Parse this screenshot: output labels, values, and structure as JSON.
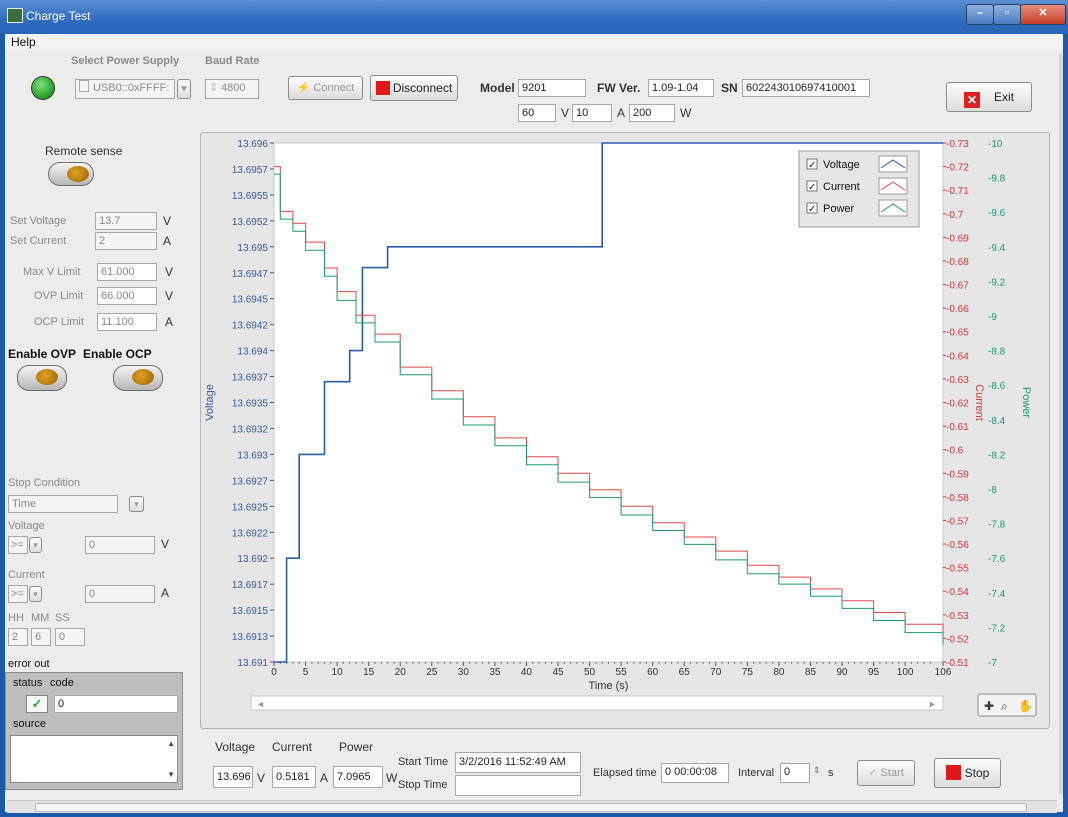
{
  "window": {
    "title": "Charge Test"
  },
  "menu": {
    "help": "Help"
  },
  "supply": {
    "select_label": "Select Power Supply",
    "port": "USB0::0xFFFF:",
    "baud_label": "Baud Rate",
    "baud": "4800",
    "connect_label": "Connect",
    "disconnect_label": "Disconnect",
    "status_color": "#2ea62e"
  },
  "device": {
    "model_label": "Model",
    "model": "9201",
    "fw_label": "FW Ver.",
    "fw": "1.09-1.04",
    "sn_label": "SN",
    "sn": "602243010697410001",
    "max_v": "60",
    "max_v_unit": "V",
    "max_a": "10",
    "max_a_unit": "A",
    "max_w": "200",
    "max_w_unit": "W"
  },
  "exit_label": "Exit",
  "settings": {
    "remote_sense": "Remote sense",
    "set_voltage_label": "Set Voltage",
    "set_voltage": "13.7",
    "set_voltage_unit": "V",
    "set_current_label": "Set Current",
    "set_current": "2",
    "set_current_unit": "A",
    "max_v_limit_label": "Max V Limit",
    "max_v_limit": "61.000",
    "max_v_limit_unit": "V",
    "ovp_limit_label": "OVP Limit",
    "ovp_limit": "66.000",
    "ovp_limit_unit": "V",
    "ocp_limit_label": "OCP Limit",
    "ocp_limit": "11.100",
    "ocp_limit_unit": "A",
    "enable_ovp": "Enable OVP",
    "enable_ocp": "Enable OCP"
  },
  "stop_condition": {
    "label": "Stop Condition",
    "mode": "Time",
    "voltage_label": "Voltage",
    "voltage_op": ">=",
    "voltage_value": "0",
    "voltage_unit": "V",
    "current_label": "Current",
    "current_op": ">=",
    "current_value": "0",
    "current_unit": "A",
    "hh_label": "HH",
    "mm_label": "MM",
    "ss_label": "SS",
    "hh": "2",
    "mm": "6",
    "ss": "0"
  },
  "error_out": {
    "title": "error out",
    "status_label": "status",
    "code_label": "code",
    "code": "0",
    "source_label": "source"
  },
  "readings": {
    "voltage_label": "Voltage",
    "voltage": "13.696",
    "voltage_unit": "V",
    "current_label": "Current",
    "current": "0.5181",
    "current_unit": "A",
    "power_label": "Power",
    "power": "7.0965",
    "power_unit": "W",
    "start_time_label": "Start Time",
    "start_time": "3/2/2016 11:52:49 AM",
    "stop_time_label": "Stop Time",
    "stop_time": "",
    "elapsed_label": "Elapsed time",
    "elapsed": "0 00:00:08",
    "interval_label": "Interval",
    "interval": "0",
    "interval_unit": "s",
    "start_label": "Start",
    "stop_label": "Stop"
  },
  "chart_data": {
    "type": "line",
    "xlabel": "Time (s)",
    "ylabel_left": "Voltage",
    "ylabel_right1": "Current",
    "ylabel_right2": "Power",
    "xlim": [
      0,
      106
    ],
    "x_ticks": [
      0,
      5,
      10,
      15,
      20,
      25,
      30,
      35,
      40,
      45,
      50,
      55,
      60,
      65,
      70,
      75,
      80,
      85,
      90,
      95,
      100,
      106
    ],
    "y_left_ticks": [
      "13.696",
      "13.6957",
      "13.6955",
      "13.6952",
      "13.695",
      "13.6947",
      "13.6945",
      "13.6942",
      "13.694",
      "13.6937",
      "13.6935",
      "13.6932",
      "13.693",
      "13.6927",
      "13.6925",
      "13.6922",
      "13.692",
      "13.6917",
      "13.6915",
      "13.6913",
      "13.691"
    ],
    "y_right1_ticks": [
      "-0.73",
      "-0.72",
      "-0.71",
      "-0.7",
      "-0.69",
      "-0.68",
      "-0.67",
      "-0.66",
      "-0.65",
      "-0.64",
      "-0.63",
      "-0.62",
      "-0.61",
      "-0.6",
      "-0.59",
      "-0.58",
      "-0.57",
      "-0.56",
      "-0.55",
      "-0.54",
      "-0.53",
      "-0.52",
      "-0.51"
    ],
    "y_right2_ticks": [
      "-10",
      "-9.8",
      "-9.6",
      "-9.4",
      "-9.2",
      "-9",
      "-8.8",
      "-8.6",
      "-8.4",
      "-8.2",
      "-8",
      "-7.8",
      "-7.6",
      "-7.4",
      "-7.2",
      "-7"
    ],
    "ylim_left": [
      13.691,
      13.696
    ],
    "ylim_right1": [
      -0.73,
      -0.51
    ],
    "ylim_right2": [
      -10,
      -7
    ],
    "series": [
      {
        "name": "Voltage",
        "color": "#2a5caa",
        "x": [
          0,
          2,
          2,
          4,
          4,
          8,
          8,
          12,
          12,
          14,
          14,
          18,
          18,
          52,
          52,
          106
        ],
        "y": [
          13.691,
          13.691,
          13.692,
          13.692,
          13.693,
          13.693,
          13.6937,
          13.6937,
          13.694,
          13.694,
          13.6948,
          13.6948,
          13.695,
          13.695,
          13.696,
          13.696
        ]
      },
      {
        "name": "Current",
        "color": "#e04848",
        "x": [
          0,
          1,
          3,
          5,
          8,
          10,
          13,
          16,
          20,
          25,
          30,
          35,
          40,
          45,
          50,
          55,
          60,
          65,
          70,
          75,
          80,
          85,
          90,
          95,
          100,
          106
        ],
        "y": [
          -0.72,
          -0.701,
          -0.696,
          -0.688,
          -0.677,
          -0.667,
          -0.657,
          -0.649,
          -0.635,
          -0.625,
          -0.614,
          -0.605,
          -0.597,
          -0.59,
          -0.583,
          -0.576,
          -0.569,
          -0.563,
          -0.557,
          -0.551,
          -0.546,
          -0.541,
          -0.536,
          -0.531,
          -0.526,
          -0.521
        ]
      },
      {
        "name": "Power",
        "color": "#1c9a74",
        "x": [
          0,
          1,
          3,
          5,
          8,
          10,
          13,
          16,
          20,
          25,
          30,
          35,
          40,
          45,
          50,
          55,
          60,
          65,
          70,
          75,
          80,
          85,
          90,
          95,
          100,
          106
        ],
        "y": [
          -9.82,
          -9.56,
          -9.49,
          -9.38,
          -9.23,
          -9.09,
          -8.96,
          -8.85,
          -8.66,
          -8.52,
          -8.37,
          -8.25,
          -8.14,
          -8.04,
          -7.95,
          -7.85,
          -7.76,
          -7.68,
          -7.59,
          -7.51,
          -7.45,
          -7.38,
          -7.31,
          -7.24,
          -7.17,
          -7.1
        ]
      }
    ],
    "legend": {
      "position": "top-right",
      "items": [
        "Voltage",
        "Current",
        "Power"
      ]
    }
  }
}
